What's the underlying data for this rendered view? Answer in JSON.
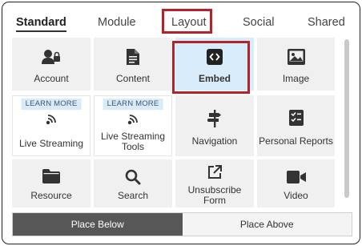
{
  "tabs": [
    {
      "label": "Standard",
      "active": true
    },
    {
      "label": "Module",
      "active": false
    },
    {
      "label": "Layout",
      "active": false
    },
    {
      "label": "Social",
      "active": false
    },
    {
      "label": "Shared",
      "active": false
    }
  ],
  "tiles": [
    {
      "label": "Account",
      "icon": "account-lock-icon"
    },
    {
      "label": "Content",
      "icon": "document-icon"
    },
    {
      "label": "Embed",
      "icon": "embed-code-icon",
      "selected": true
    },
    {
      "label": "Image",
      "icon": "image-icon"
    },
    {
      "label": "Live Streaming",
      "icon": "live-streaming-icon",
      "badge": "LEARN MORE"
    },
    {
      "label": "Live Streaming Tools",
      "icon": "live-streaming-icon",
      "badge": "LEARN MORE"
    },
    {
      "label": "Navigation",
      "icon": "signpost-icon"
    },
    {
      "label": "Personal Reports",
      "icon": "checklist-icon"
    },
    {
      "label": "Resource",
      "icon": "folder-icon"
    },
    {
      "label": "Search",
      "icon": "search-icon"
    },
    {
      "label": "Unsubscribe Form",
      "icon": "external-link-icon"
    },
    {
      "label": "Video",
      "icon": "video-camera-icon"
    }
  ],
  "placement": {
    "below_label": "Place Below",
    "above_label": "Place Above",
    "selected": "below"
  },
  "colors": {
    "highlight": "#b0242a",
    "selected_tile": "#d9ecfb",
    "tile": "#f0f0f1",
    "active_button": "#575757"
  }
}
